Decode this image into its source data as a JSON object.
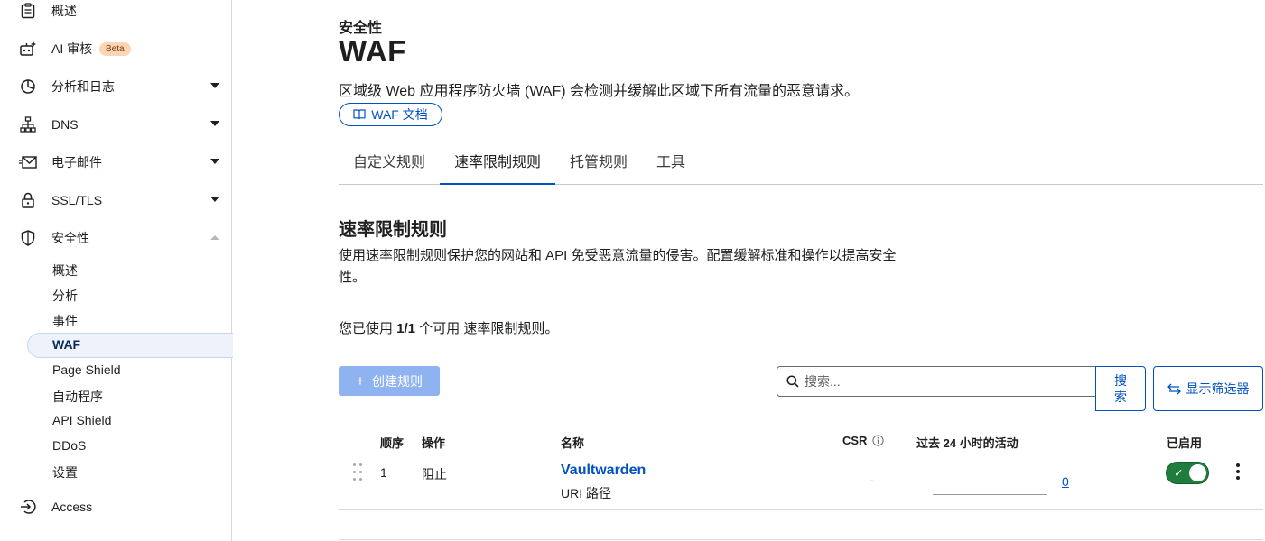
{
  "sidebar": {
    "items": [
      {
        "label": "概述",
        "icon": "clipboard-icon"
      },
      {
        "label": "AI 审核",
        "icon": "robot-icon",
        "badge": "Beta"
      },
      {
        "label": "分析和日志",
        "icon": "pie-chart-icon"
      },
      {
        "label": "DNS",
        "icon": "network-icon"
      },
      {
        "label": "电子邮件",
        "icon": "email-icon"
      },
      {
        "label": "SSL/TLS",
        "icon": "lock-icon"
      },
      {
        "label": "安全性",
        "icon": "shield-icon"
      },
      {
        "label": "Access",
        "icon": "login-icon"
      }
    ],
    "security_sub": [
      "概述",
      "分析",
      "事件",
      "WAF",
      "Page Shield",
      "自动程序",
      "API Shield",
      "DDoS",
      "设置"
    ]
  },
  "header": {
    "breadcrumb": "安全性",
    "title": "WAF",
    "description": "区域级 Web 应用程序防火墙 (WAF) 会检测并缓解此区域下所有流量的恶意请求。",
    "doc_button": "WAF 文档"
  },
  "tabs": [
    "自定义规则",
    "速率限制规则",
    "托管规则",
    "工具"
  ],
  "active_tab": "速率限制规则",
  "section": {
    "title": "速率限制规则",
    "description": "使用速率限制规则保护您的网站和 API 免受恶意流量的侵害。配置缓解标准和操作以提高安全性。",
    "usage_prefix": "您已使用 ",
    "usage_count": "1/1",
    "usage_suffix": " 个可用 速率限制规则。"
  },
  "toolbar": {
    "create_label": "创建规则",
    "search_placeholder": "搜索...",
    "search_button": "搜索",
    "filter_button": "显示筛选器"
  },
  "table": {
    "headers": {
      "order": "顺序",
      "action": "操作",
      "name": "名称",
      "csr": "CSR",
      "activity": "过去 24 小时的活动",
      "enabled": "已启用"
    },
    "rows": [
      {
        "order": "1",
        "action": "阻止",
        "name": "Vaultwarden",
        "subtitle": "URI 路径",
        "csr": "-",
        "activity": "0",
        "enabled": true
      }
    ]
  },
  "colors": {
    "accent": "#0051c3",
    "toggle_on": "#1e7d3c",
    "beta_bg": "#fbd5b5"
  }
}
